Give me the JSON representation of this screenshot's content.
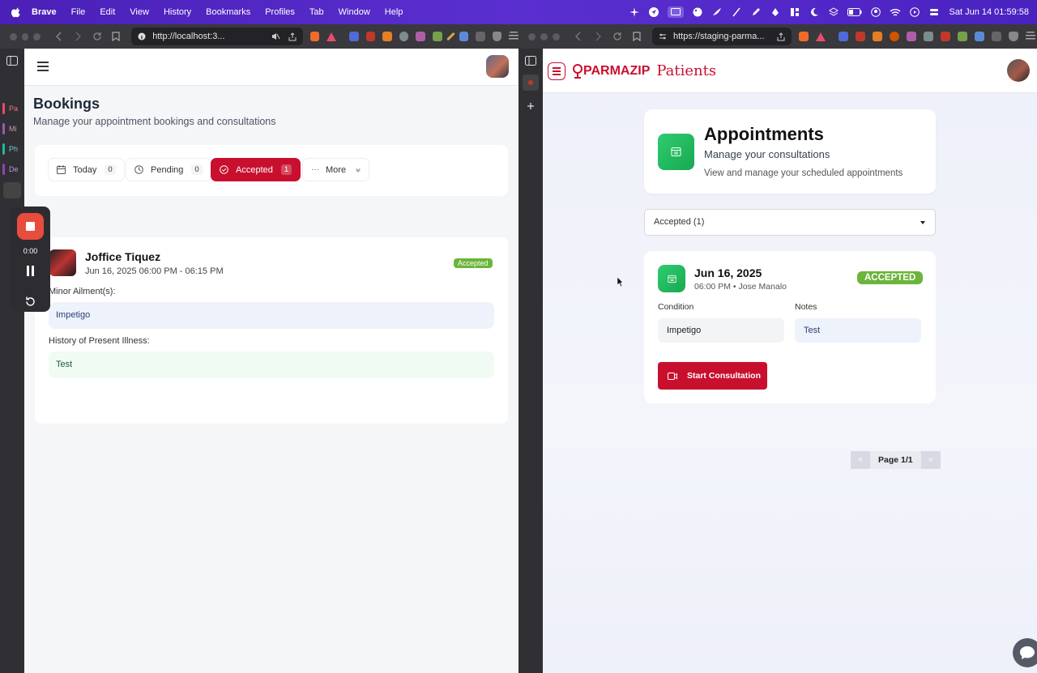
{
  "menubar": {
    "app": "Brave",
    "items": [
      "File",
      "Edit",
      "View",
      "History",
      "Bookmarks",
      "Profiles",
      "Tab",
      "Window",
      "Help"
    ],
    "clock": "Sat Jun 14  01:59:58"
  },
  "left_window": {
    "url": "http://localhost:3...",
    "sidebar_tabs": [
      "Pa",
      "Mi",
      "Ph",
      "De"
    ],
    "page": {
      "title": "Bookings",
      "subtitle": "Manage your appointment bookings and consultations",
      "tabs": [
        {
          "label": "Today",
          "count": "0"
        },
        {
          "label": "Pending",
          "count": "0"
        },
        {
          "label": "Accepted",
          "count": "1"
        },
        {
          "label": "More"
        }
      ],
      "booking": {
        "patient_name": "Joffice Tiquez",
        "datetime": "Jun 16, 2025 06:00 PM - 06:15 PM",
        "status": "Accepted",
        "ailment_label": "Minor Ailment(s):",
        "ailment_value": "Impetigo",
        "history_label": "History of Present Illness:",
        "history_value": "Test"
      }
    },
    "recorder": {
      "time": "0:00"
    }
  },
  "right_window": {
    "url": "https://staging-parma...",
    "page": {
      "brand": "PARMAZIP",
      "brand_section": "Patients",
      "appointments_title": "Appointments",
      "appointments_subtitle": "Manage your consultations",
      "appointments_desc": "View and manage your scheduled appointments",
      "filter_value": "Accepted (1)",
      "appointment": {
        "date": "Jun 16, 2025",
        "time_doctor": "06:00 PM • Jose Manalo",
        "status": "ACCEPTED",
        "condition_label": "Condition",
        "condition_value": "Impetigo",
        "notes_label": "Notes",
        "notes_value": "Test",
        "action_label": "Start Consultation"
      },
      "pager": {
        "prev": "«",
        "label": "Page 1/1",
        "next": "»"
      }
    }
  },
  "colors": {
    "brand_red": "#c8102e",
    "accepted_green": "#6bb53a",
    "icon_green": "#22c55e",
    "menubar_purple": "#5128c4"
  }
}
